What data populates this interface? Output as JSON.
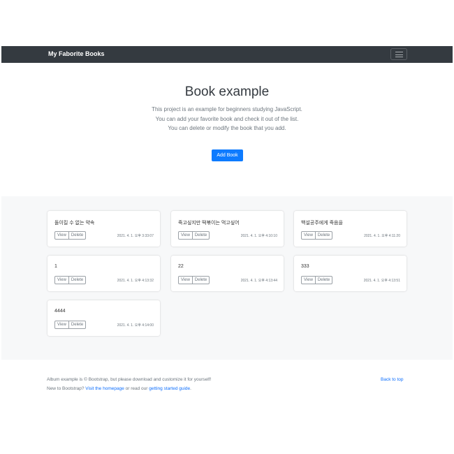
{
  "navbar": {
    "brand": "My Faborite Books"
  },
  "hero": {
    "title": "Book example",
    "lines": [
      "This project is an example for beginners studying JavaScript.",
      "You can add your favorite book and check it out of the list.",
      "You can delete or modify the book that you add."
    ],
    "add_button": "Add Book"
  },
  "books": [
    {
      "title": "돌이킬 수 없는 약속",
      "time": "2021. 4. 1. 오후 3:33:07"
    },
    {
      "title": "죽고싶지만 떡볶이는 먹고싶어",
      "time": "2021. 4. 1. 오후 4:10:10"
    },
    {
      "title": "백설공주에게 죽음을",
      "time": "2021. 4. 1. 오후 4:11:20"
    },
    {
      "title": "1",
      "time": "2021. 4. 1. 오후 4:13:32"
    },
    {
      "title": "22",
      "time": "2021. 4. 1. 오후 4:13:44"
    },
    {
      "title": "333",
      "time": "2021. 4. 1. 오후 4:13:51"
    },
    {
      "title": "4444",
      "time": "2021. 4. 1. 오후 4:14:00"
    }
  ],
  "card_buttons": {
    "view": "View",
    "delete": "Delete"
  },
  "footer": {
    "line1": "Album example is © Bootstrap, but please download and customize it for yourself!",
    "line2_prefix": "New to Bootstrap? ",
    "homepage_link": "Visit the homepage",
    "line2_middle": " or read our ",
    "guide_link": "getting started guide",
    "line2_suffix": ".",
    "back_to_top": "Back to top"
  }
}
